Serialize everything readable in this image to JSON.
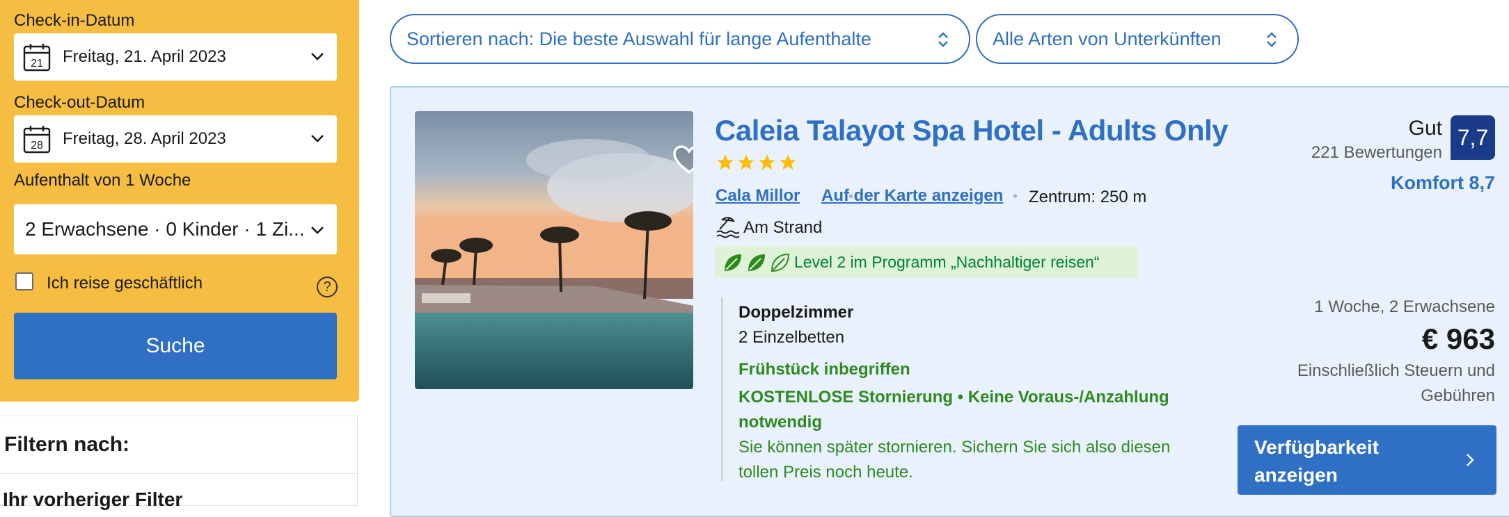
{
  "sidebar": {
    "checkin_label": "Check-in-Datum",
    "checkin_day": "21",
    "checkin_value": "Freitag, 21. April 2023",
    "checkout_label": "Check-out-Datum",
    "checkout_day": "28",
    "checkout_value": "Freitag, 28. April 2023",
    "stay_length": "Aufenthalt von 1 Woche",
    "guests_value": "2 Erwachsene · 0 Kinder · 1 Zi...",
    "business_label": "Ich reise geschäftlich",
    "help_icon": "?",
    "search_button": "Suche",
    "filter_title": "Filtern nach:",
    "filter_sub": "Ihr vorheriger Filter"
  },
  "toolbar": {
    "sort_label": "Sortieren nach: Die beste Auswahl für lange Aufenthalte",
    "type_label": "Alle Arten von Unterkünften"
  },
  "hotel": {
    "name": "Caleia Talayot Spa Hotel - Adults Only",
    "stars": 4,
    "location_link": "Cala Millor",
    "map_link": "Auf der Karte anzeigen",
    "distance": "Zentrum: 250 m",
    "beach": "Am Strand",
    "sustainability": "Level 2 im Programm „Nachhaltiger reisen“",
    "room_type": "Doppelzimmer",
    "beds": "2 Einzelbetten",
    "breakfast": "Frühstück inbegriffen",
    "cancellation": "KOSTENLOSE Stornierung • Keine Voraus-/Anzahlung notwendig",
    "cancel_later": "Sie können später stornieren. Sichern Sie sich also diesen tollen Preis noch heute.",
    "rating_word": "Gut",
    "reviews": "221 Bewertungen",
    "score": "7,7",
    "comfort": "Komfort 8,7",
    "stay_info": "1 Woche, 2 Erwachsene",
    "price": "€ 963",
    "tax_note": "Einschließlich Steuern und Gebühren",
    "availability_button": "Verfügbarkeit anzeigen"
  },
  "colors": {
    "brand_blue": "#2f6fc4",
    "panel_yellow": "#f5bd41",
    "score_navy": "#1a3a8a",
    "green": "#2e8a1f"
  }
}
